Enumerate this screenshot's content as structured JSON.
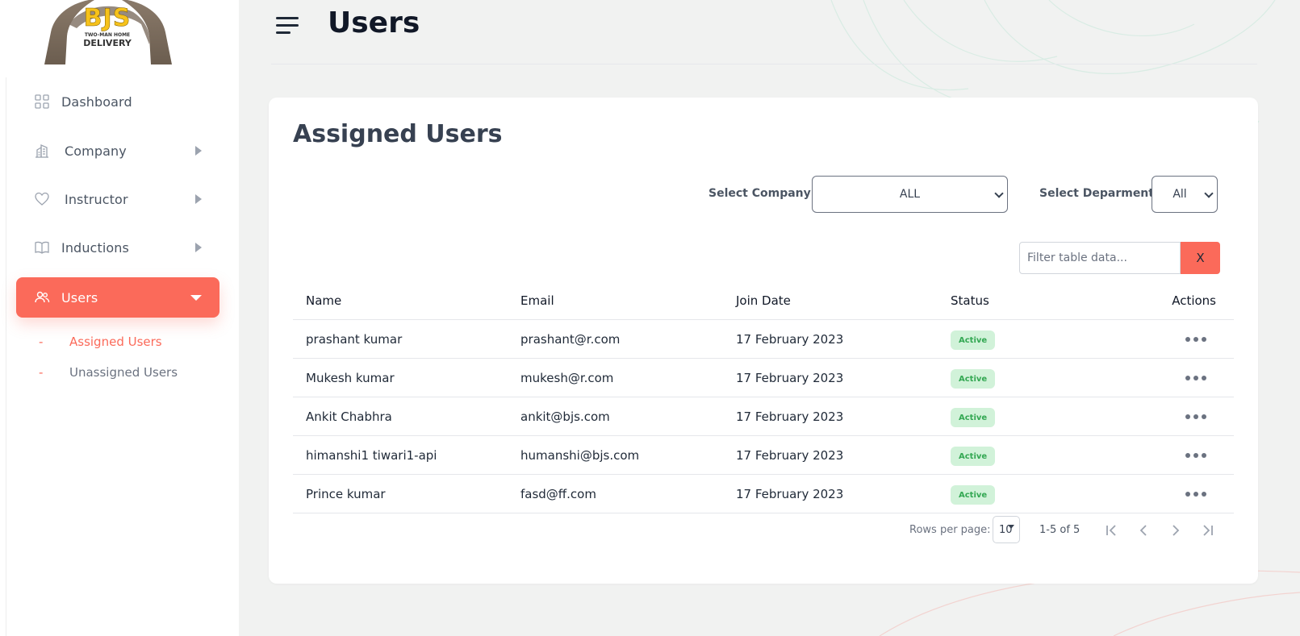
{
  "logo": {
    "line1": "BJS",
    "line2": "TWO-MAN HOME",
    "line3": "DELIVERY"
  },
  "sidebar": {
    "items": [
      {
        "label": "Dashboard",
        "icon": "grid-icon"
      },
      {
        "label": "Company",
        "icon": "building-icon"
      },
      {
        "label": "Instructor",
        "icon": "heart-icon"
      },
      {
        "label": "Inductions",
        "icon": "book-icon"
      },
      {
        "label": "Users",
        "icon": "users-icon"
      }
    ],
    "sub_items": [
      {
        "dash": "-",
        "label": "Assigned Users"
      },
      {
        "dash": "-",
        "label": "Unassigned Users"
      }
    ]
  },
  "header": {
    "title": "Users"
  },
  "card": {
    "title": "Assigned Users",
    "company_label": "Select Company",
    "company_value": "ALL",
    "department_label": "Select Deparment",
    "department_value": "All",
    "filter_placeholder": "Filter table data...",
    "clear_label": "X"
  },
  "table": {
    "columns": [
      "Name",
      "Email",
      "Join Date",
      "Status",
      "Actions"
    ],
    "rows": [
      {
        "name": "prashant kumar",
        "email": "prashant@r.com",
        "join_date": "17 February 2023",
        "status": "Active"
      },
      {
        "name": "Mukesh kumar",
        "email": "mukesh@r.com",
        "join_date": "17 February 2023",
        "status": "Active"
      },
      {
        "name": "Ankit Chabhra",
        "email": "ankit@bjs.com",
        "join_date": "17 February 2023",
        "status": "Active"
      },
      {
        "name": "himanshi1 tiwari1-api",
        "email": "humanshi@bjs.com",
        "join_date": "17 February 2023",
        "status": "Active"
      },
      {
        "name": "Prince kumar",
        "email": "fasd@ff.com",
        "join_date": "17 February 2023",
        "status": "Active"
      }
    ]
  },
  "pagination": {
    "rows_per_page_label": "Rows per page:",
    "rows_per_page": "10",
    "range": "1-5 of 5"
  },
  "colors": {
    "accent": "#fb6a5a",
    "badge_bg": "#d1f2d9",
    "badge_text": "#34a853"
  }
}
